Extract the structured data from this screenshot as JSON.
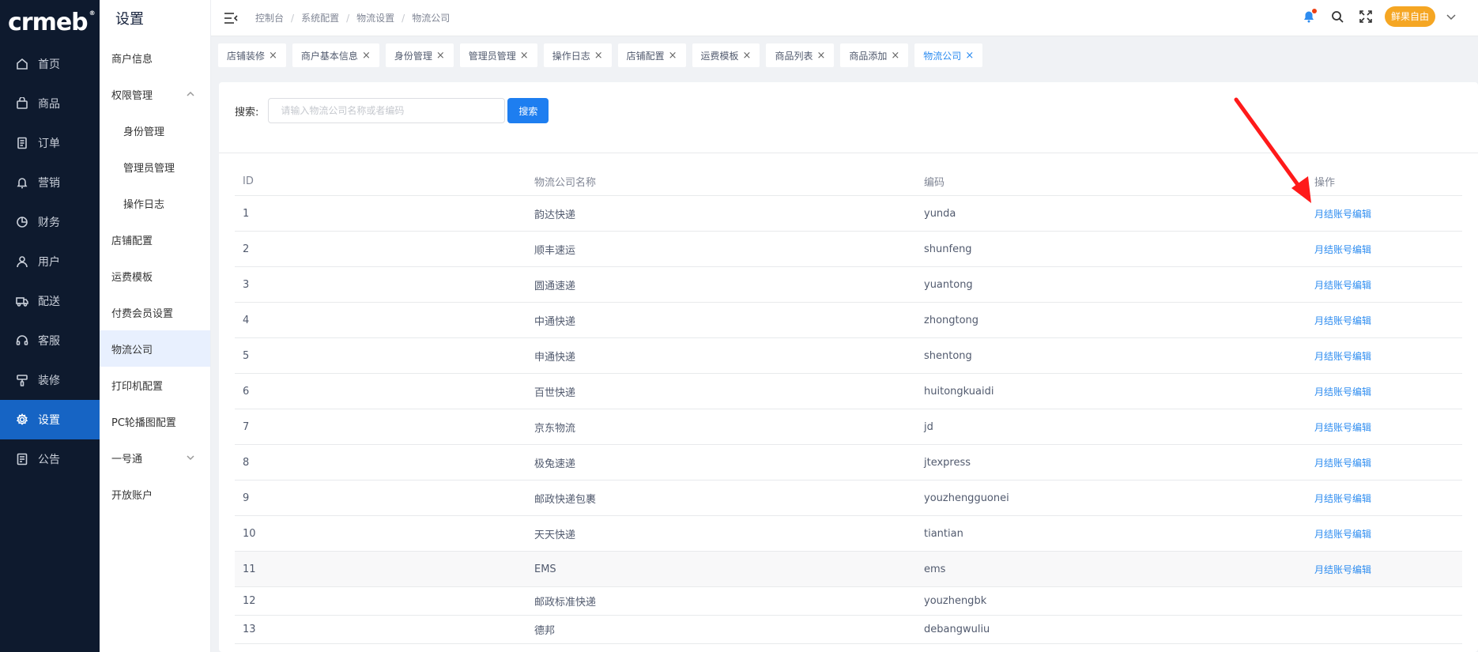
{
  "nav": {
    "logo": "crmeb",
    "items": [
      {
        "label": "首页",
        "icon": "home-icon"
      },
      {
        "label": "商品",
        "icon": "bag-icon"
      },
      {
        "label": "订单",
        "icon": "order-icon"
      },
      {
        "label": "营销",
        "icon": "bell-icon"
      },
      {
        "label": "财务",
        "icon": "pie-icon"
      },
      {
        "label": "用户",
        "icon": "user-icon"
      },
      {
        "label": "配送",
        "icon": "truck-icon"
      },
      {
        "label": "客服",
        "icon": "headset-icon"
      },
      {
        "label": "装修",
        "icon": "paint-icon"
      },
      {
        "label": "设置",
        "icon": "gear-icon"
      },
      {
        "label": "公告",
        "icon": "notice-icon"
      }
    ],
    "active_index": 9
  },
  "sub": {
    "title": "设置",
    "items": [
      {
        "label": "商户信息"
      },
      {
        "label": "权限管理"
      },
      {
        "label": "身份管理"
      },
      {
        "label": "管理员管理"
      },
      {
        "label": "操作日志"
      },
      {
        "label": "店铺配置"
      },
      {
        "label": "运费模板"
      },
      {
        "label": "付费会员设置"
      },
      {
        "label": "物流公司"
      },
      {
        "label": "打印机配置"
      },
      {
        "label": "PC轮播图配置"
      },
      {
        "label": "一号通"
      },
      {
        "label": "开放账户"
      }
    ]
  },
  "header": {
    "breadcrumbs": [
      "控制台",
      "系统配置",
      "物流设置",
      "物流公司"
    ],
    "separator": "/",
    "user": "鲜果自由"
  },
  "tags": [
    {
      "label": "店铺装修"
    },
    {
      "label": "商户基本信息"
    },
    {
      "label": "身份管理"
    },
    {
      "label": "管理员管理"
    },
    {
      "label": "操作日志"
    },
    {
      "label": "店铺配置"
    },
    {
      "label": "运费模板"
    },
    {
      "label": "商品列表"
    },
    {
      "label": "商品添加"
    },
    {
      "label": "物流公司"
    }
  ],
  "search": {
    "label": "搜索:",
    "placeholder": "请输入物流公司名称或者编码",
    "button": "搜索"
  },
  "table": {
    "columns": [
      "ID",
      "物流公司名称",
      "编码",
      "操作"
    ],
    "rows": [
      {
        "id": "1",
        "name": "韵达快递",
        "code": "yunda",
        "op": "月结账号编辑"
      },
      {
        "id": "2",
        "name": "顺丰速运",
        "code": "shunfeng",
        "op": "月结账号编辑"
      },
      {
        "id": "3",
        "name": "圆通速递",
        "code": "yuantong",
        "op": "月结账号编辑"
      },
      {
        "id": "4",
        "name": "中通快递",
        "code": "zhongtong",
        "op": "月结账号编辑"
      },
      {
        "id": "5",
        "name": "申通快递",
        "code": "shentong",
        "op": "月结账号编辑"
      },
      {
        "id": "6",
        "name": "百世快递",
        "code": "huitongkuaidi",
        "op": "月结账号编辑"
      },
      {
        "id": "7",
        "name": "京东物流",
        "code": "jd",
        "op": "月结账号编辑"
      },
      {
        "id": "8",
        "name": "极兔速递",
        "code": "jtexpress",
        "op": "月结账号编辑"
      },
      {
        "id": "9",
        "name": "邮政快递包裹",
        "code": "youzhengguonei",
        "op": "月结账号编辑"
      },
      {
        "id": "10",
        "name": "天天快递",
        "code": "tiantian",
        "op": "月结账号编辑"
      },
      {
        "id": "11",
        "name": "EMS",
        "code": "ems",
        "op": "月结账号编辑"
      },
      {
        "id": "12",
        "name": "邮政标准快递",
        "code": "youzhengbk",
        "op": ""
      },
      {
        "id": "13",
        "name": "德邦",
        "code": "debangwuliu",
        "op": ""
      }
    ]
  },
  "colors": {
    "nav_bg": "#0e1a2e",
    "nav_active": "#1664c4",
    "primary": "#2d8cf0",
    "arrow": "#ff1a1a",
    "user_badge": "#f5a623"
  }
}
